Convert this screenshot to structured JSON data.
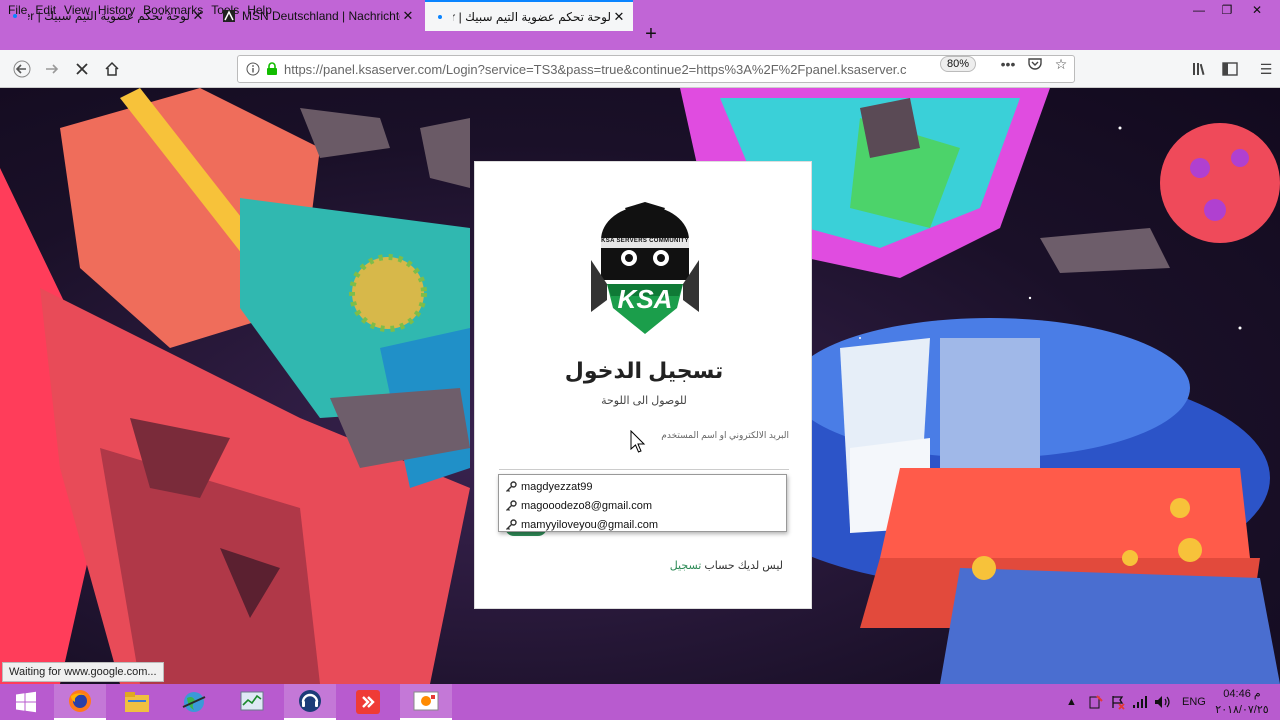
{
  "menu": {
    "items": [
      "File",
      "Edit",
      "View",
      "History",
      "Bookmarks",
      "Tools",
      "Help"
    ]
  },
  "tabs": [
    {
      "title": "لوحة تحكم عضوية التيم سبيك | er"
    },
    {
      "title": "MSN Deutschland | Nachrichten"
    },
    {
      "title": "لوحة تحكم عضوية التيم سبيك | er"
    }
  ],
  "newtab_label": "+",
  "address": {
    "url": "https://panel.ksaserver.com/Login?service=TS3&pass=true&continue2=https%3A%2F%2Fpanel.ksaserver.c",
    "zoom": "80%"
  },
  "login": {
    "logo_text": "KSA",
    "logo_banner": "KSA SERVERS COMMUNITY",
    "title": "تسجيل الدخول",
    "subtitle": "للوصول الى اللوحة",
    "field_label": "البريد الالكتروني او اسم المستخدم",
    "signup_text": "ليس لديك حساب",
    "signup_link": "تسجيل"
  },
  "autocomplete": [
    "magdyezzat99",
    "magooodezo8@gmail.com",
    "mamyyiloveyou@gmail.com"
  ],
  "status_text": "Waiting for www.google.com...",
  "tray": {
    "lang": "ENG",
    "time": "04:46 م",
    "date": "٢٠١٨/٠٧/٢٥"
  },
  "colors": {
    "chrome": "#c165d6",
    "taskbar": "#b85bcf",
    "accent": "#2e8b57",
    "tab_indicator": "#0a84ff"
  }
}
